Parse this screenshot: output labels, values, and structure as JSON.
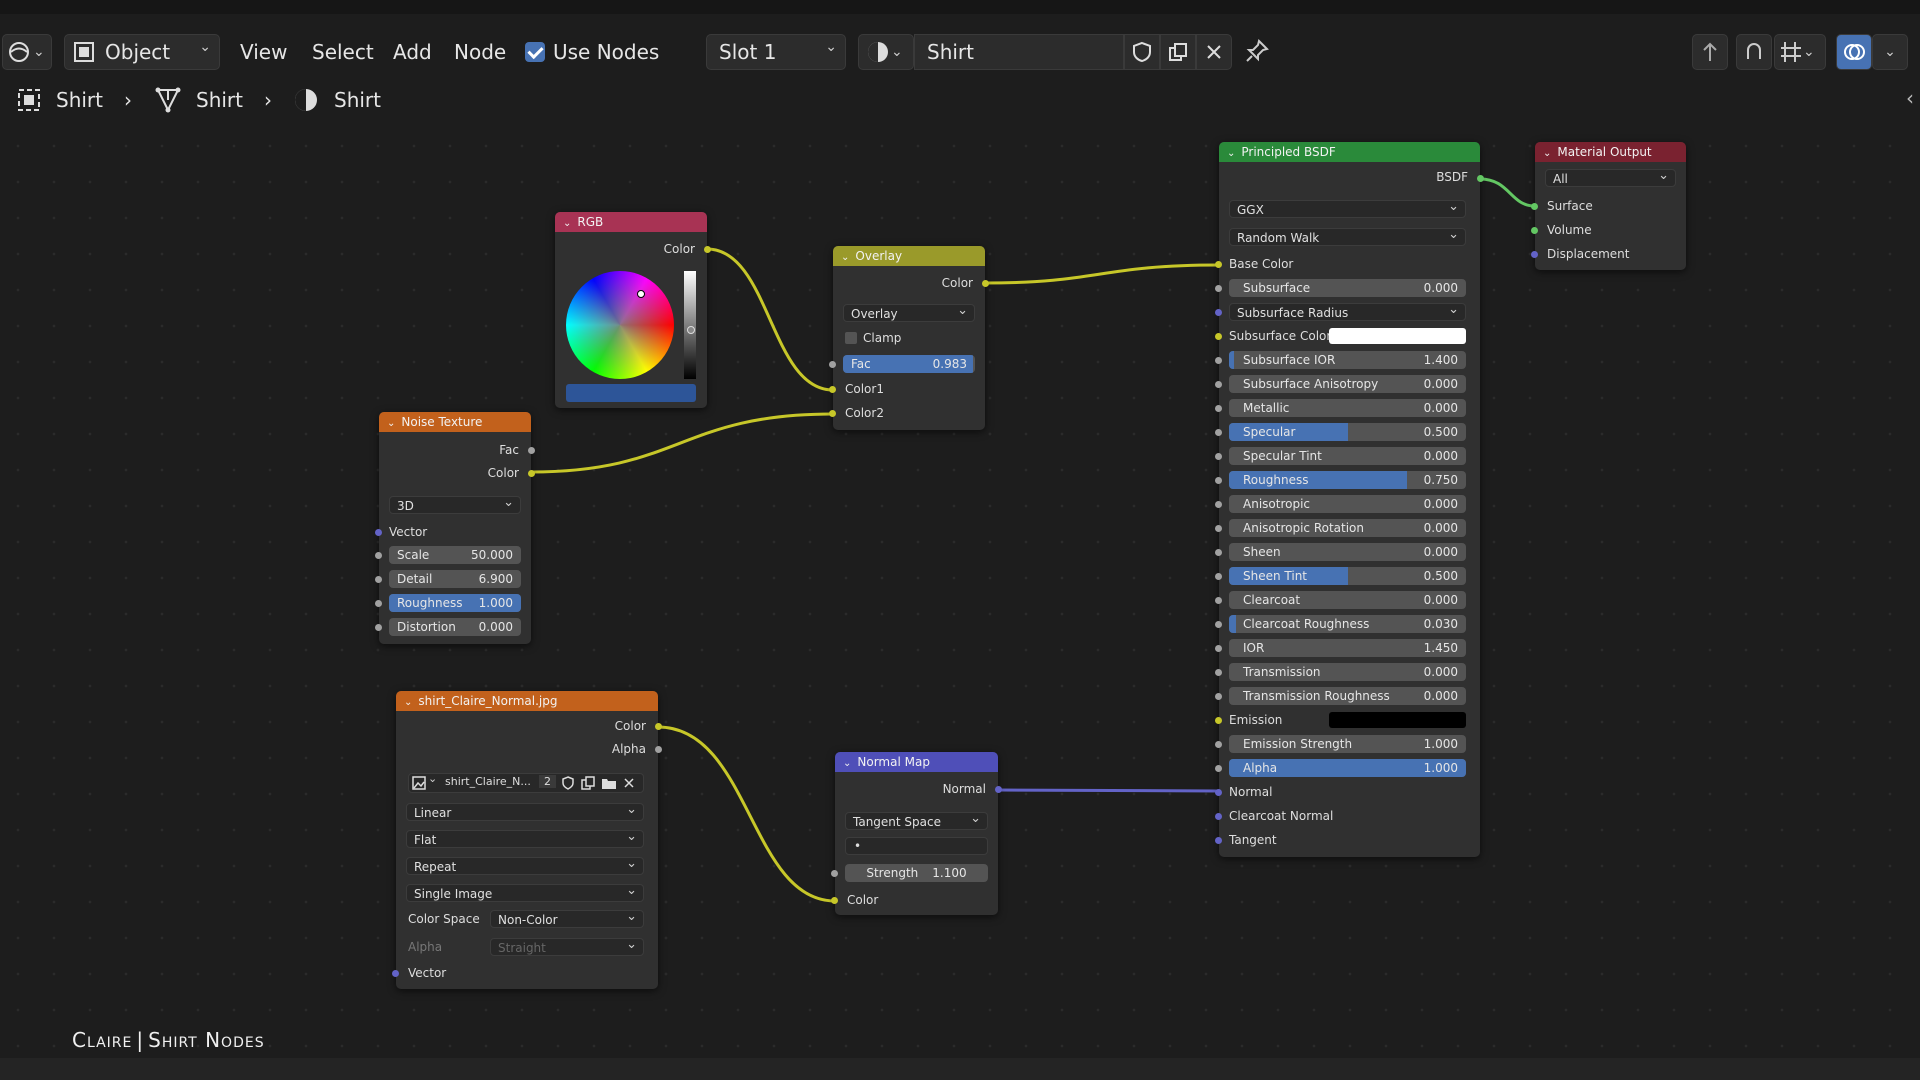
{
  "header": {
    "mode_label": "Object",
    "menus": [
      "View",
      "Select",
      "Add",
      "Node"
    ],
    "use_nodes_label": "Use Nodes",
    "slot_label": "Slot 1",
    "material_name": "Shirt"
  },
  "breadcrumb": [
    "Shirt",
    "Shirt",
    "Shirt"
  ],
  "caption": {
    "name": "Claire",
    "sep": "|",
    "title": "Shirt Nodes"
  },
  "colors": {
    "wire_yellow": "#c7c729",
    "wire_purple": "#6363c7",
    "wire_green": "#63c763",
    "accent": "#4772b3"
  },
  "nodes": {
    "rgb": {
      "title": "RGB",
      "out_color": "Color"
    },
    "overlay": {
      "title": "Overlay",
      "out_color": "Color",
      "blend": "Overlay",
      "clamp": "Clamp",
      "fac_label": "Fac",
      "fac_value": "0.983",
      "fac_frac": 0.983,
      "in1": "Color1",
      "in2": "Color2"
    },
    "noise": {
      "title": "Noise Texture",
      "out_fac": "Fac",
      "out_color": "Color",
      "dim": "3D",
      "vector": "Vector",
      "fields": [
        {
          "label": "Scale",
          "value": "50.000",
          "frac": 0
        },
        {
          "label": "Detail",
          "value": "6.900",
          "frac": 0
        },
        {
          "label": "Roughness",
          "value": "1.000",
          "frac": 1
        },
        {
          "label": "Distortion",
          "value": "0.000",
          "frac": 0
        }
      ]
    },
    "image": {
      "title": "shirt_Claire_Normal.jpg",
      "out_color": "Color",
      "out_alpha": "Alpha",
      "image_name": "shirt_Claire_N...",
      "users": "2",
      "interp": "Linear",
      "proj": "Flat",
      "ext": "Repeat",
      "source": "Single Image",
      "colorspace_label": "Color Space",
      "colorspace": "Non-Color",
      "alpha_label": "Alpha",
      "alpha": "Straight",
      "vector": "Vector"
    },
    "normalmap": {
      "title": "Normal Map",
      "out_normal": "Normal",
      "space": "Tangent Space",
      "uv": "•",
      "strength_label": "Strength",
      "strength_value": "1.100",
      "in_color": "Color"
    },
    "bsdf": {
      "title": "Principled BSDF",
      "out": "BSDF",
      "distribution": "GGX",
      "subsurface_method": "Random Walk",
      "base_color": "Base Color",
      "rows": [
        {
          "label": "Subsurface",
          "value": "0.000",
          "frac": 0
        },
        {
          "label": "Subsurface Radius",
          "dropdown": true
        },
        {
          "label": "Subsurface Color",
          "swatch": "#ffffff"
        },
        {
          "label": "Subsurface IOR",
          "value": "1.400",
          "frac": 0.02
        },
        {
          "label": "Subsurface Anisotropy",
          "value": "0.000",
          "frac": 0
        },
        {
          "label": "Metallic",
          "value": "0.000",
          "frac": 0
        },
        {
          "label": "Specular",
          "value": "0.500",
          "frac": 0.5
        },
        {
          "label": "Specular Tint",
          "value": "0.000",
          "frac": 0
        },
        {
          "label": "Roughness",
          "value": "0.750",
          "frac": 0.75
        },
        {
          "label": "Anisotropic",
          "value": "0.000",
          "frac": 0
        },
        {
          "label": "Anisotropic Rotation",
          "value": "0.000",
          "frac": 0
        },
        {
          "label": "Sheen",
          "value": "0.000",
          "frac": 0
        },
        {
          "label": "Sheen Tint",
          "value": "0.500",
          "frac": 0.5
        },
        {
          "label": "Clearcoat",
          "value": "0.000",
          "frac": 0
        },
        {
          "label": "Clearcoat Roughness",
          "value": "0.030",
          "frac": 0.03
        },
        {
          "label": "IOR",
          "value": "1.450",
          "frac": 0
        },
        {
          "label": "Transmission",
          "value": "0.000",
          "frac": 0
        },
        {
          "label": "Transmission Roughness",
          "value": "0.000",
          "frac": 0
        },
        {
          "label": "Emission",
          "swatch": "#000000"
        },
        {
          "label": "Emission Strength",
          "value": "1.000",
          "frac": 0
        },
        {
          "label": "Alpha",
          "value": "1.000",
          "frac": 1
        },
        {
          "label": "Normal",
          "plain": true
        },
        {
          "label": "Clearcoat Normal",
          "plain": true
        },
        {
          "label": "Tangent",
          "plain": true
        }
      ]
    },
    "output": {
      "title": "Material Output",
      "target": "All",
      "inputs": [
        "Surface",
        "Volume",
        "Displacement"
      ]
    }
  }
}
